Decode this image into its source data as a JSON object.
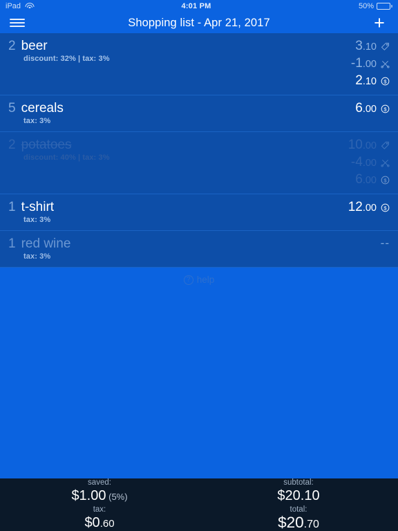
{
  "status_bar": {
    "device": "iPad",
    "wifi_icon": "wifi-icon",
    "time": "4:01 PM",
    "battery_percent": "50%",
    "battery_level": 50
  },
  "navbar": {
    "menu_icon": "hamburger-menu-icon",
    "title": "Shopping list - Apr 21, 2017",
    "add_icon": "plus-icon",
    "add_label": "+"
  },
  "colors": {
    "page_background": "#0b63e0",
    "row_background": "#0d4ea8",
    "row_divider": "#1a63c4",
    "accent_text": "#ffffff",
    "muted_text": "#8fb3e2",
    "totals_background": "#0b1929"
  },
  "list": {
    "items": [
      {
        "qty": "2",
        "name": "beer",
        "sub": "discount: 32% | tax: 3%",
        "state": "active",
        "prices": [
          {
            "int": "3",
            "dec": ".10",
            "icon": "price-tag-icon",
            "muted": true
          },
          {
            "int": "-1",
            "dec": ".00",
            "icon": "scissors-discount-icon",
            "muted": true
          },
          {
            "int": "2",
            "dec": ".10",
            "icon": "coin-total-icon",
            "muted": false
          }
        ]
      },
      {
        "qty": "5",
        "name": "cereals",
        "sub": "tax: 3%",
        "state": "active",
        "prices": [
          {
            "int": "6",
            "dec": ".00",
            "icon": "coin-total-icon",
            "muted": false
          }
        ]
      },
      {
        "qty": "2",
        "name": "potatoes",
        "sub": "discount: 40% | tax: 3%",
        "state": "done",
        "prices": [
          {
            "int": "10",
            "dec": ".00",
            "icon": "price-tag-icon",
            "muted": true
          },
          {
            "int": "-4",
            "dec": ".00",
            "icon": "scissors-discount-icon",
            "muted": true
          },
          {
            "int": "6",
            "dec": ".00",
            "icon": "coin-total-icon",
            "muted": false
          }
        ]
      },
      {
        "qty": "1",
        "name": "t-shirt",
        "sub": "tax: 3%",
        "state": "active",
        "prices": [
          {
            "int": "12",
            "dec": ".00",
            "icon": "coin-total-icon",
            "muted": false
          }
        ]
      },
      {
        "qty": "1",
        "name": "red wine",
        "sub": "tax: 3%",
        "state": "empty",
        "prices": [
          {
            "int": "--",
            "dec": "",
            "icon": "",
            "muted": true,
            "dash": true
          }
        ]
      }
    ]
  },
  "help": {
    "icon": "question-mark-circle-icon",
    "icon_glyph": "?",
    "label": "help"
  },
  "totals": {
    "left": [
      {
        "label": "saved:",
        "big": "$1.00",
        "small": "",
        "pct": "(5%)",
        "large": false
      },
      {
        "label": "tax:",
        "big": "$0",
        "small": ".60",
        "pct": "",
        "large": false
      }
    ],
    "right": [
      {
        "label": "subtotal:",
        "big": "$20.10",
        "small": "",
        "pct": "",
        "large": false
      },
      {
        "label": "total:",
        "big": "$20",
        "small": ".70",
        "pct": "",
        "large": true
      }
    ]
  }
}
